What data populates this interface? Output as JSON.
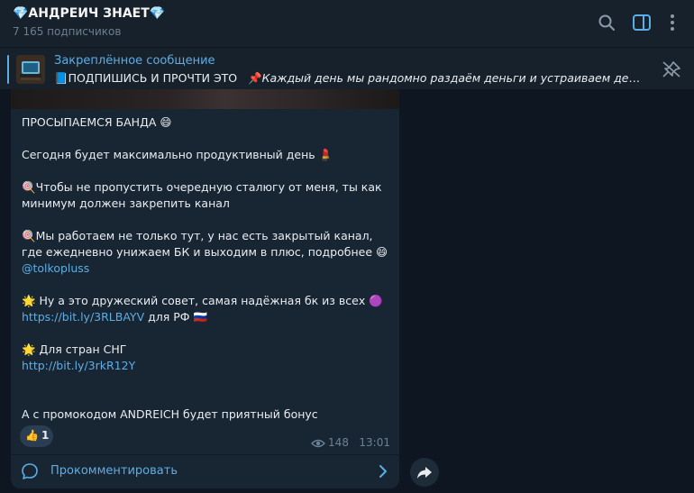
{
  "channel": {
    "title": "💎АНДРЕИЧ ЗНАЕТ💎",
    "subscribers": "7 165 подписчиков"
  },
  "header_icons": [
    "search-icon",
    "sidebar-toggle-icon",
    "more-vertical-icon"
  ],
  "pinned": {
    "label": "Закреплённое сообщение",
    "prefix": "📘ПОДПИШИСЬ И ПРОЧТИ ЭТО",
    "pin_emoji": "📌",
    "italic_text": "Каждый день мы рандомно раздаём деньги и устраиваем денежн..."
  },
  "message": {
    "line1": "ПРОСЫПАЕМСЯ БАНДА 😄",
    "line2": "Сегодня будет максимально продуктивный день 💄",
    "para3": "🍭Чтобы не пропустить очередную сталюгу от меня, ты как минимум должен закрепить канал",
    "para4": "🍭Мы работаем не только тут, у нас есть закрытый канал, где ежедневно унижаем БК и выходим в плюс, подробнее 😄",
    "link_tolko": "@tolkopluss",
    "para5": "🌟 Ну а это дружеский совет, самая надёжная бк из всех 🟣",
    "link_rf": "https://bit.ly/3RLBAYV",
    "rf_suffix": " для РФ 🇷🇺",
    "para6": "🌟 Для стран СНГ",
    "link_sng": "http://bit.ly/3rkR12Y",
    "para7": "А с промокодом ANDREICH будет приятный бонус"
  },
  "reaction": {
    "emoji": "👍",
    "count": "1"
  },
  "meta": {
    "views": "148",
    "time": "13:01"
  },
  "comment_label": "Прокомментировать",
  "colors": {
    "background": "#0e1621",
    "panel": "#17212b",
    "bubble": "#182533",
    "accent": "#5caee6"
  }
}
